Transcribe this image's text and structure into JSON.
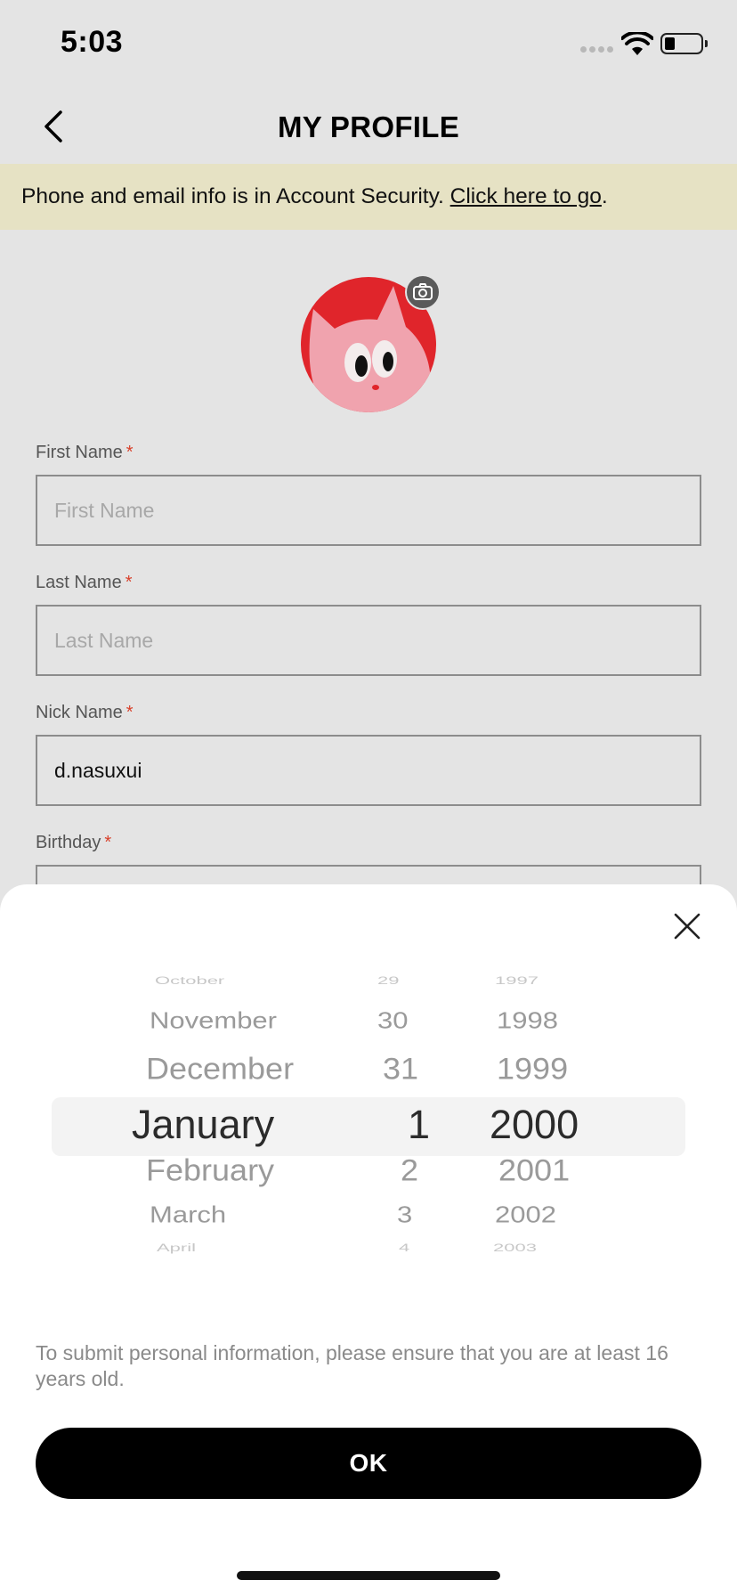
{
  "status_bar": {
    "time": "5:03"
  },
  "header": {
    "title": "MY PROFILE"
  },
  "notice": {
    "text": "Phone and email info is in Account Security. ",
    "link": "Click here to go",
    "suffix": "."
  },
  "form": {
    "first_name": {
      "label": "First Name",
      "required_mark": "*",
      "placeholder": "First Name",
      "value": ""
    },
    "last_name": {
      "label": "Last Name",
      "required_mark": "*",
      "placeholder": "Last Name",
      "value": ""
    },
    "nick_name": {
      "label": "Nick Name",
      "required_mark": "*",
      "value": "d.nasuxui"
    },
    "birthday": {
      "label": "Birthday",
      "required_mark": "*"
    }
  },
  "date_picker": {
    "months": [
      "October",
      "November",
      "December",
      "January",
      "February",
      "March",
      "April"
    ],
    "days": [
      "29",
      "30",
      "31",
      "1",
      "2",
      "3",
      "4"
    ],
    "years": [
      "1997",
      "1998",
      "1999",
      "2000",
      "2001",
      "2002",
      "2003"
    ],
    "selected": {
      "month": "January",
      "day": "1",
      "year": "2000"
    }
  },
  "sheet": {
    "disclaimer": "To submit personal information, please ensure that you are at least 16 years old.",
    "ok_label": "OK"
  },
  "colors": {
    "background": "#e4e4e4",
    "notice_bg": "#e6e2c4",
    "avatar_red": "#e0252b",
    "required_red": "#d8402a",
    "button_black": "#000000"
  },
  "icons": [
    "back-arrow-icon",
    "camera-icon",
    "close-icon",
    "wifi-icon",
    "battery-icon",
    "signal-icon"
  ]
}
